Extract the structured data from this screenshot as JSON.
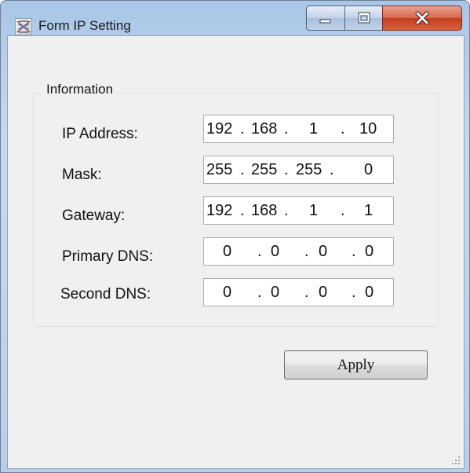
{
  "window": {
    "title": "Form IP Setting",
    "icons": {
      "app": "network-setup-icon",
      "minimize": "minimize-icon",
      "maximize": "maximize-icon",
      "close": "close-icon"
    },
    "colors": {
      "close_button": "#c94a2c",
      "frame": "#b6cfea"
    }
  },
  "group": {
    "title": "Information"
  },
  "fields": [
    {
      "label": "IP Address:",
      "octets": [
        "192",
        "168",
        "1",
        "10"
      ]
    },
    {
      "label": "Mask:",
      "octets": [
        "255",
        "255",
        "255",
        "0"
      ]
    },
    {
      "label": "Gateway:",
      "octets": [
        "192",
        "168",
        "1",
        "1"
      ]
    },
    {
      "label": "Primary DNS:",
      "octets": [
        "0",
        "0",
        "0",
        "0"
      ]
    },
    {
      "label": "Second DNS:",
      "octets": [
        "0",
        "0",
        "0",
        "0"
      ]
    }
  ],
  "separator": ".",
  "apply_button": {
    "label": "Apply"
  }
}
